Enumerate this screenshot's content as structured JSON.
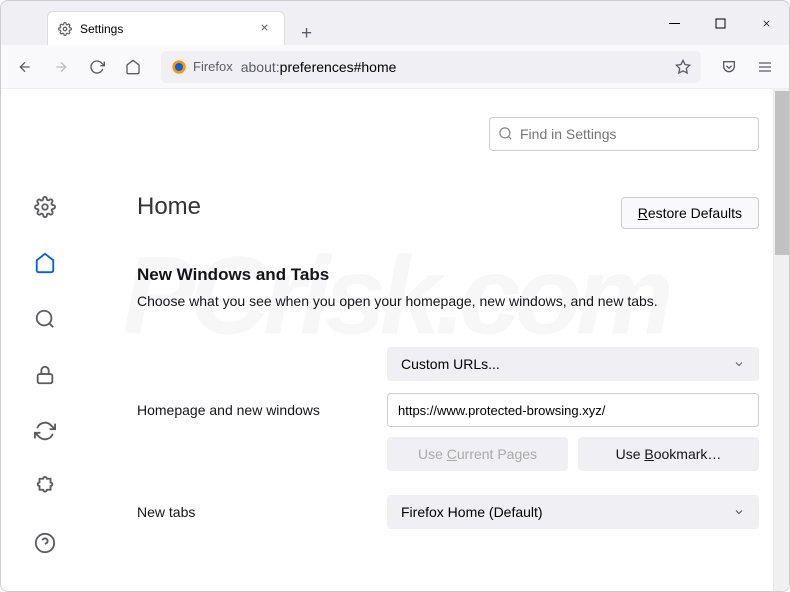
{
  "tab": {
    "title": "Settings"
  },
  "urlbar": {
    "identity": "Firefox",
    "url_prefix": "about:",
    "url_path": "preferences#home"
  },
  "search": {
    "placeholder": "Find in Settings"
  },
  "page": {
    "title": "Home",
    "restore_label": "Restore Defaults",
    "restore_underline": "R"
  },
  "section": {
    "title": "New Windows and Tabs",
    "desc": "Choose what you see when you open your homepage, new windows, and new tabs."
  },
  "homepage_dropdown": {
    "value": "Custom URLs..."
  },
  "homepage": {
    "label": "Homepage and new windows",
    "url": "https://www.protected-browsing.xyz/"
  },
  "buttons": {
    "use_current": "Use Current Pages",
    "use_bookmark": "Use Bookmark…"
  },
  "newtabs": {
    "label": "New tabs",
    "value": "Firefox Home (Default)"
  }
}
